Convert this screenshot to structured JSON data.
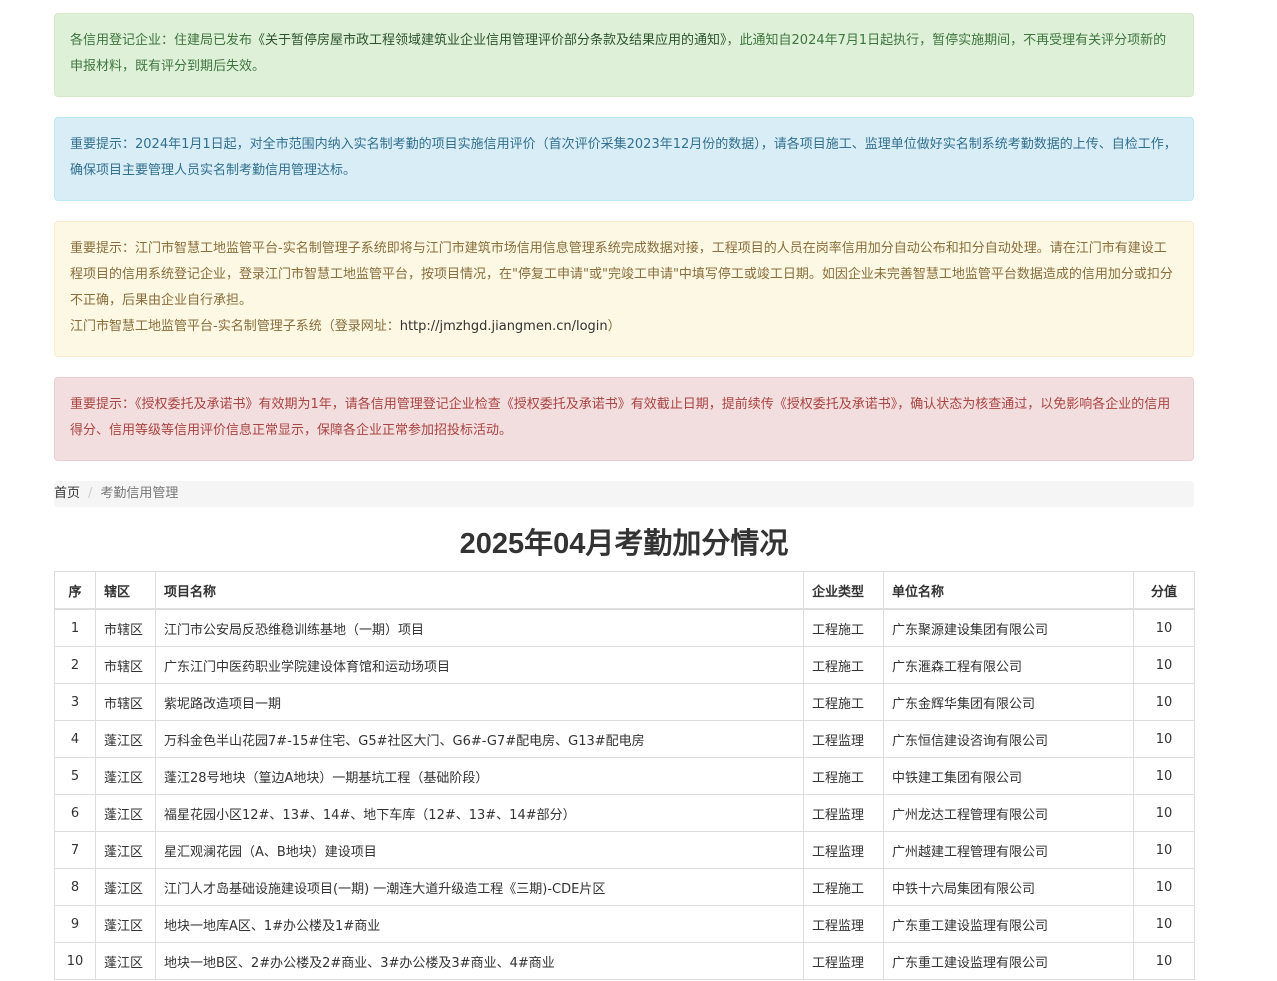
{
  "notices": {
    "success": {
      "prefix": "各信用登记企业：住建局已发布",
      "doc": "《关于暂停房屋市政工程领域建筑业企业信用管理评价部分条款及结果应用的通知》",
      "suffix": "，此通知自2024年7月1日起执行，暂停实施期间，不再受理有关评分项新的申报材料，既有评分到期后失效。"
    },
    "info": "重要提示：2024年1月1日起，对全市范围内纳入实名制考勤的项目实施信用评价（首次评价采集2023年12月份的数据），请各项目施工、监理单位做好实名制系统考勤数据的上传、自检工作，确保项目主要管理人员实名制考勤信用管理达标。",
    "warning": {
      "text": "重要提示：江门市智慧工地监管平台-实名制管理子系统即将与江门市建筑市场信用信息管理系统完成数据对接，工程项目的人员在岗率信用加分自动公布和扣分自动处理。请在江门市有建设工程项目的信用系统登记企业，登录江门市智慧工地监管平台，按项目情况，在\"停复工申请\"或\"完竣工申请\"中填写停工或竣工日期。如因企业未完善智慧工地监管平台数据造成的信用加分或扣分不正确，后果由企业自行承担。",
      "line2_prefix": "江门市智慧工地监管平台-实名制管理子系统（登录网址：",
      "url": "http://jmzhgd.jiangmen.cn/login",
      "line2_suffix": "）"
    },
    "danger": "重要提示：《授权委托及承诺书》有效期为1年，请各信用管理登记企业检查《授权委托及承诺书》有效截止日期，提前续传《授权委托及承诺书》，确认状态为核查通过，以免影响各企业的信用得分、信用等级等信用评价信息正常显示，保障各企业正常参加招投标活动。"
  },
  "breadcrumb": {
    "home": "首页",
    "separator": "/",
    "current": "考勤信用管理"
  },
  "page_title": "2025年04月考勤加分情况",
  "table": {
    "headers": {
      "index": "序",
      "district": "辖区",
      "project": "项目名称",
      "type": "企业类型",
      "company": "单位名称",
      "score": "分值"
    },
    "rows": [
      {
        "index": "1",
        "district": "市辖区",
        "project": "江门市公安局反恐维稳训练基地（一期）项目",
        "type": "工程施工",
        "company": "广东聚源建设集团有限公司",
        "score": "10"
      },
      {
        "index": "2",
        "district": "市辖区",
        "project": "广东江门中医药职业学院建设体育馆和运动场项目",
        "type": "工程施工",
        "company": "广东滙森工程有限公司",
        "score": "10"
      },
      {
        "index": "3",
        "district": "市辖区",
        "project": "紫坭路改造项目一期",
        "type": "工程施工",
        "company": "广东金辉华集团有限公司",
        "score": "10"
      },
      {
        "index": "4",
        "district": "蓬江区",
        "project": "万科金色半山花园7#-15#住宅、G5#社区大门、G6#-G7#配电房、G13#配电房",
        "type": "工程监理",
        "company": "广东恒信建设咨询有限公司",
        "score": "10"
      },
      {
        "index": "5",
        "district": "蓬江区",
        "project": "蓬江28号地块（篁边A地块）一期基坑工程（基础阶段）",
        "type": "工程施工",
        "company": "中铁建工集团有限公司",
        "score": "10"
      },
      {
        "index": "6",
        "district": "蓬江区",
        "project": "福星花园小区12#、13#、14#、地下车库（12#、13#、14#部分）",
        "type": "工程监理",
        "company": "广州龙达工程管理有限公司",
        "score": "10"
      },
      {
        "index": "7",
        "district": "蓬江区",
        "project": "星汇观澜花园（A、B地块）建设项目",
        "type": "工程监理",
        "company": "广州越建工程管理有限公司",
        "score": "10"
      },
      {
        "index": "8",
        "district": "蓬江区",
        "project": "江门人才岛基础设施建设项目(一期) 一潮连大道升级造工程《三期)-CDE片区",
        "type": "工程施工",
        "company": "中铁十六局集团有限公司",
        "score": "10"
      },
      {
        "index": "9",
        "district": "蓬江区",
        "project": "地块一地库A区、1#办公楼及1#商业",
        "type": "工程监理",
        "company": "广东重工建设监理有限公司",
        "score": "10"
      },
      {
        "index": "10",
        "district": "蓬江区",
        "project": "地块一地B区、2#办公楼及2#商业、3#办公楼及3#商业、4#商业",
        "type": "工程监理",
        "company": "广东重工建设监理有限公司",
        "score": "10"
      }
    ]
  }
}
